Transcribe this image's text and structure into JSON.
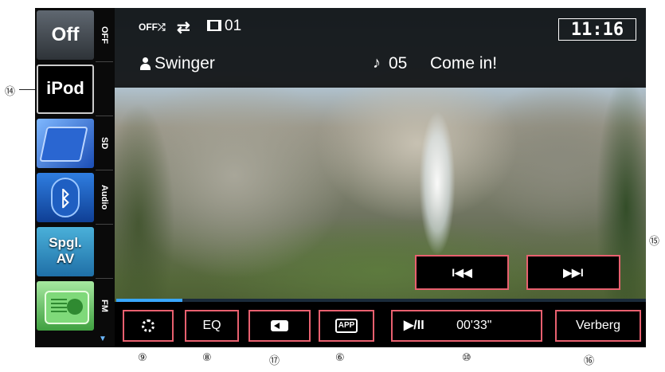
{
  "sidebar": {
    "sources": [
      {
        "label": "Off",
        "side_label": "OFF",
        "name": "source-off"
      },
      {
        "label": "iPod",
        "side_label": "",
        "name": "source-ipod"
      },
      {
        "label": "",
        "side_label": "SD",
        "name": "source-sd"
      },
      {
        "label": "",
        "side_label": "Audio",
        "name": "source-bluetooth-audio"
      },
      {
        "label": "Spgl.\nAV",
        "side_label": "",
        "name": "source-mirror-av"
      },
      {
        "label": "",
        "side_label": "FM",
        "name": "source-fm"
      }
    ]
  },
  "header": {
    "shuffle": "OFF⤮",
    "track_index": "01",
    "clock": "11:16",
    "artist": "Swinger",
    "track_number": "05",
    "song_title": "Come in!"
  },
  "progress": {
    "fraction": 0.125,
    "color": "#39a7ff"
  },
  "controls": {
    "eq_label": "EQ",
    "play_pause_label": "▶/II",
    "elapsed_time": "00'33\"",
    "hide_label": "Verberg",
    "prev_label": "I◀◀",
    "next_label": "▶▶I"
  },
  "callouts": {
    "c14": "⑭",
    "c15": "⑮",
    "c9": "⑨",
    "c8": "⑧",
    "c17": "⑰",
    "c6": "⑥",
    "c10": "⑩",
    "c16": "⑯"
  },
  "icons": {
    "repeat": "⇄",
    "note": "♪",
    "scroll": "▼"
  },
  "colors": {
    "accent_border": "#e8606f",
    "progress": "#39a7ff"
  }
}
